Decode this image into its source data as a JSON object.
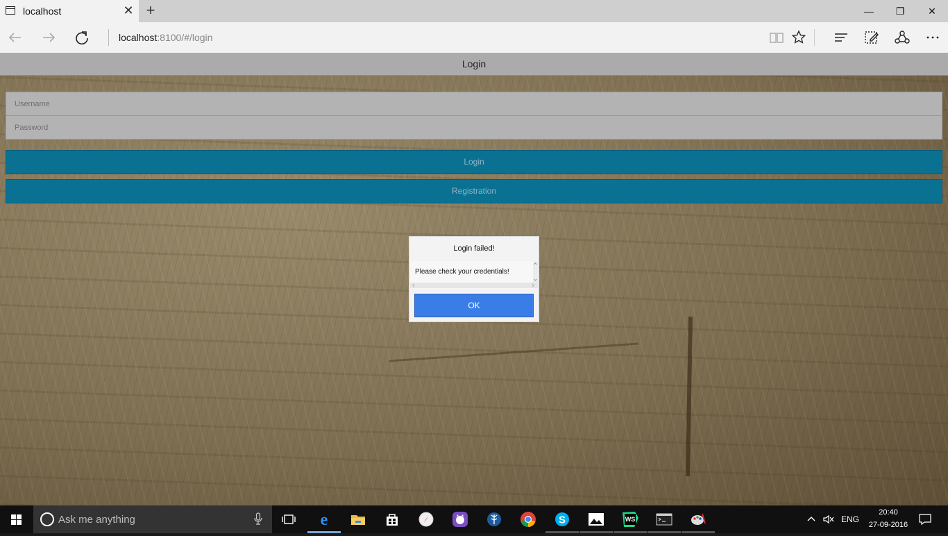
{
  "browser": {
    "tab_title": "localhost",
    "tab_close": "✕",
    "new_tab": "+",
    "address_host": "localhost",
    "address_rest": ":8100/#/login",
    "window_controls": {
      "minimize": "—",
      "restore": "❐",
      "close": "✕"
    }
  },
  "app": {
    "header_title": "Login",
    "username_placeholder": "Username",
    "password_placeholder": "Password",
    "login_button": "Login",
    "registration_button": "Registration"
  },
  "dialog": {
    "title": "Login failed!",
    "message": "Please check your credentials!",
    "ok_label": "OK"
  },
  "taskbar": {
    "search_placeholder": "Ask me anything",
    "language": "ENG",
    "time": "20:40",
    "date": "27-09-2016",
    "icons": [
      "task-view-icon",
      "edge-icon",
      "file-explorer-icon",
      "store-icon",
      "safari-icon",
      "github-desktop-icon",
      "sourcetree-icon",
      "chrome-icon",
      "skype-icon",
      "photos-icon",
      "webstorm-icon",
      "cmd-icon",
      "paint-icon"
    ]
  },
  "colors": {
    "primary_button": "#0b7192",
    "ok_button": "#3b7de6",
    "header_bar": "#ababab"
  }
}
